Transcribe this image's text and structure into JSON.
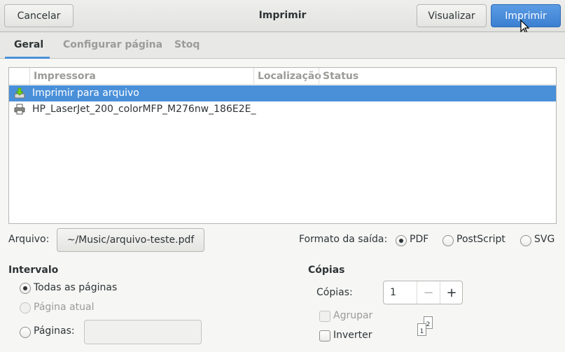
{
  "header": {
    "title": "Imprimir",
    "cancel_label": "Cancelar",
    "preview_label": "Visualizar",
    "print_label": "Imprimir"
  },
  "tabs": [
    {
      "label": "Geral"
    },
    {
      "label": "Configurar página"
    },
    {
      "label": "Stoq"
    }
  ],
  "printers": {
    "columns": [
      "Impressora",
      "Localização",
      "Status"
    ],
    "rows": [
      {
        "name": "Imprimir para arquivo",
        "location": "",
        "status": "",
        "icon": "download-file-icon"
      },
      {
        "name": "HP_LaserJet_200_colorMFP_M276nw_186E2E_",
        "location": "",
        "status": "",
        "icon": "printer-icon"
      }
    ]
  },
  "file": {
    "label": "Arquivo:",
    "value": "~/Music/arquivo-teste.pdf"
  },
  "output_format": {
    "label": "Formato da saída:",
    "options": [
      "PDF",
      "PostScript",
      "SVG"
    ],
    "selected": "PDF"
  },
  "range": {
    "heading": "Intervalo",
    "all_pages": "Todas as páginas",
    "current_page": "Página atual",
    "pages": "Páginas:",
    "pages_value": ""
  },
  "copies": {
    "heading": "Cópias",
    "label": "Cópias:",
    "value": "1",
    "minus": "−",
    "plus": "+",
    "collate": "Agrupar",
    "reverse": "Inverter",
    "page_icons": [
      "1",
      "2"
    ]
  },
  "colors": {
    "accent": "#4a90d9",
    "text": "#2e3436",
    "disabled": "#9a9c98"
  }
}
